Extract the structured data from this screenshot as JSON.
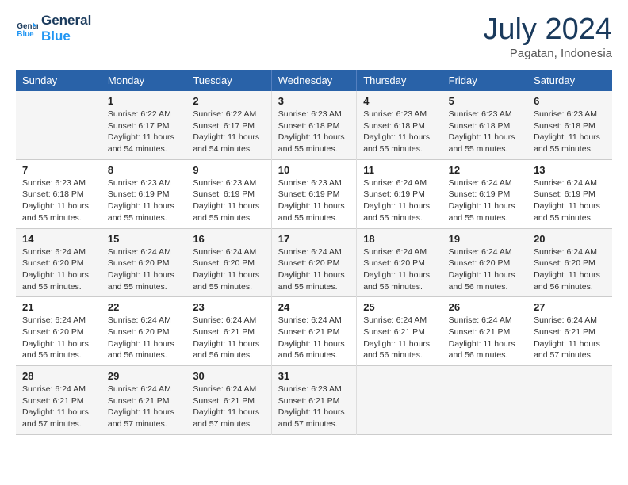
{
  "logo": {
    "line1": "General",
    "line2": "Blue"
  },
  "title": "July 2024",
  "location": "Pagatan, Indonesia",
  "weekdays": [
    "Sunday",
    "Monday",
    "Tuesday",
    "Wednesday",
    "Thursday",
    "Friday",
    "Saturday"
  ],
  "weeks": [
    [
      {
        "day": "",
        "sunrise": "",
        "sunset": "",
        "daylight": ""
      },
      {
        "day": "1",
        "sunrise": "Sunrise: 6:22 AM",
        "sunset": "Sunset: 6:17 PM",
        "daylight": "Daylight: 11 hours and 54 minutes."
      },
      {
        "day": "2",
        "sunrise": "Sunrise: 6:22 AM",
        "sunset": "Sunset: 6:17 PM",
        "daylight": "Daylight: 11 hours and 54 minutes."
      },
      {
        "day": "3",
        "sunrise": "Sunrise: 6:23 AM",
        "sunset": "Sunset: 6:18 PM",
        "daylight": "Daylight: 11 hours and 55 minutes."
      },
      {
        "day": "4",
        "sunrise": "Sunrise: 6:23 AM",
        "sunset": "Sunset: 6:18 PM",
        "daylight": "Daylight: 11 hours and 55 minutes."
      },
      {
        "day": "5",
        "sunrise": "Sunrise: 6:23 AM",
        "sunset": "Sunset: 6:18 PM",
        "daylight": "Daylight: 11 hours and 55 minutes."
      },
      {
        "day": "6",
        "sunrise": "Sunrise: 6:23 AM",
        "sunset": "Sunset: 6:18 PM",
        "daylight": "Daylight: 11 hours and 55 minutes."
      }
    ],
    [
      {
        "day": "7",
        "sunrise": "Sunrise: 6:23 AM",
        "sunset": "Sunset: 6:18 PM",
        "daylight": "Daylight: 11 hours and 55 minutes."
      },
      {
        "day": "8",
        "sunrise": "Sunrise: 6:23 AM",
        "sunset": "Sunset: 6:19 PM",
        "daylight": "Daylight: 11 hours and 55 minutes."
      },
      {
        "day": "9",
        "sunrise": "Sunrise: 6:23 AM",
        "sunset": "Sunset: 6:19 PM",
        "daylight": "Daylight: 11 hours and 55 minutes."
      },
      {
        "day": "10",
        "sunrise": "Sunrise: 6:23 AM",
        "sunset": "Sunset: 6:19 PM",
        "daylight": "Daylight: 11 hours and 55 minutes."
      },
      {
        "day": "11",
        "sunrise": "Sunrise: 6:24 AM",
        "sunset": "Sunset: 6:19 PM",
        "daylight": "Daylight: 11 hours and 55 minutes."
      },
      {
        "day": "12",
        "sunrise": "Sunrise: 6:24 AM",
        "sunset": "Sunset: 6:19 PM",
        "daylight": "Daylight: 11 hours and 55 minutes."
      },
      {
        "day": "13",
        "sunrise": "Sunrise: 6:24 AM",
        "sunset": "Sunset: 6:19 PM",
        "daylight": "Daylight: 11 hours and 55 minutes."
      }
    ],
    [
      {
        "day": "14",
        "sunrise": "Sunrise: 6:24 AM",
        "sunset": "Sunset: 6:20 PM",
        "daylight": "Daylight: 11 hours and 55 minutes."
      },
      {
        "day": "15",
        "sunrise": "Sunrise: 6:24 AM",
        "sunset": "Sunset: 6:20 PM",
        "daylight": "Daylight: 11 hours and 55 minutes."
      },
      {
        "day": "16",
        "sunrise": "Sunrise: 6:24 AM",
        "sunset": "Sunset: 6:20 PM",
        "daylight": "Daylight: 11 hours and 55 minutes."
      },
      {
        "day": "17",
        "sunrise": "Sunrise: 6:24 AM",
        "sunset": "Sunset: 6:20 PM",
        "daylight": "Daylight: 11 hours and 55 minutes."
      },
      {
        "day": "18",
        "sunrise": "Sunrise: 6:24 AM",
        "sunset": "Sunset: 6:20 PM",
        "daylight": "Daylight: 11 hours and 56 minutes."
      },
      {
        "day": "19",
        "sunrise": "Sunrise: 6:24 AM",
        "sunset": "Sunset: 6:20 PM",
        "daylight": "Daylight: 11 hours and 56 minutes."
      },
      {
        "day": "20",
        "sunrise": "Sunrise: 6:24 AM",
        "sunset": "Sunset: 6:20 PM",
        "daylight": "Daylight: 11 hours and 56 minutes."
      }
    ],
    [
      {
        "day": "21",
        "sunrise": "Sunrise: 6:24 AM",
        "sunset": "Sunset: 6:20 PM",
        "daylight": "Daylight: 11 hours and 56 minutes."
      },
      {
        "day": "22",
        "sunrise": "Sunrise: 6:24 AM",
        "sunset": "Sunset: 6:20 PM",
        "daylight": "Daylight: 11 hours and 56 minutes."
      },
      {
        "day": "23",
        "sunrise": "Sunrise: 6:24 AM",
        "sunset": "Sunset: 6:21 PM",
        "daylight": "Daylight: 11 hours and 56 minutes."
      },
      {
        "day": "24",
        "sunrise": "Sunrise: 6:24 AM",
        "sunset": "Sunset: 6:21 PM",
        "daylight": "Daylight: 11 hours and 56 minutes."
      },
      {
        "day": "25",
        "sunrise": "Sunrise: 6:24 AM",
        "sunset": "Sunset: 6:21 PM",
        "daylight": "Daylight: 11 hours and 56 minutes."
      },
      {
        "day": "26",
        "sunrise": "Sunrise: 6:24 AM",
        "sunset": "Sunset: 6:21 PM",
        "daylight": "Daylight: 11 hours and 56 minutes."
      },
      {
        "day": "27",
        "sunrise": "Sunrise: 6:24 AM",
        "sunset": "Sunset: 6:21 PM",
        "daylight": "Daylight: 11 hours and 57 minutes."
      }
    ],
    [
      {
        "day": "28",
        "sunrise": "Sunrise: 6:24 AM",
        "sunset": "Sunset: 6:21 PM",
        "daylight": "Daylight: 11 hours and 57 minutes."
      },
      {
        "day": "29",
        "sunrise": "Sunrise: 6:24 AM",
        "sunset": "Sunset: 6:21 PM",
        "daylight": "Daylight: 11 hours and 57 minutes."
      },
      {
        "day": "30",
        "sunrise": "Sunrise: 6:24 AM",
        "sunset": "Sunset: 6:21 PM",
        "daylight": "Daylight: 11 hours and 57 minutes."
      },
      {
        "day": "31",
        "sunrise": "Sunrise: 6:23 AM",
        "sunset": "Sunset: 6:21 PM",
        "daylight": "Daylight: 11 hours and 57 minutes."
      },
      {
        "day": "",
        "sunrise": "",
        "sunset": "",
        "daylight": ""
      },
      {
        "day": "",
        "sunrise": "",
        "sunset": "",
        "daylight": ""
      },
      {
        "day": "",
        "sunrise": "",
        "sunset": "",
        "daylight": ""
      }
    ]
  ]
}
